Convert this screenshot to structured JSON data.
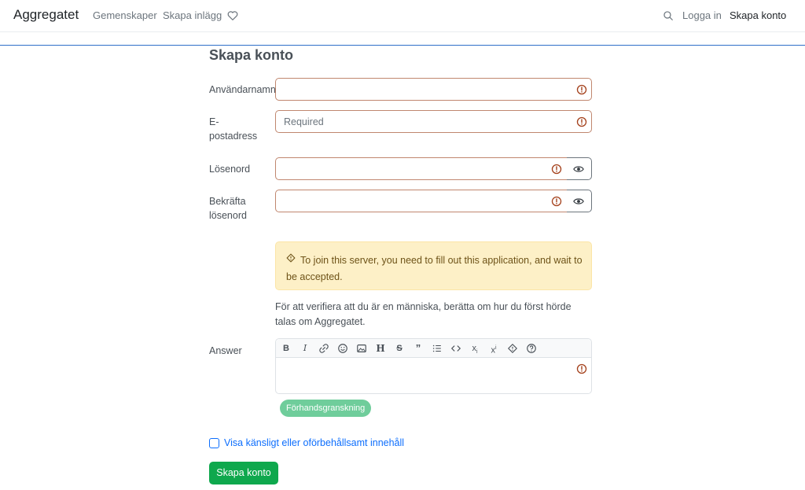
{
  "nav": {
    "brand": "Aggregatet",
    "links": [
      "Gemenskaper",
      "Skapa inlägg"
    ],
    "login": "Logga in",
    "signup": "Skapa konto"
  },
  "form": {
    "title": "Skapa konto",
    "username_label": "Användarnamn",
    "email_label_1": "E-",
    "email_label_2": "postadress",
    "email_placeholder": "Required",
    "password_label": "Lösenord",
    "confirm_label_1": "Bekräfta",
    "confirm_label_2": "lösenord",
    "application_alert": "To join this server, you need to fill out this application, and wait to be accepted.",
    "verify_question": "För att verifiera att du är en människa, berätta om hur du först hörde talas om Aggregatet.",
    "answer_label": "Answer",
    "preview_button": "Förhandsgranskning",
    "nsfw_label": "Visa känsligt eller oförbehållsamt innehåll",
    "submit_button": "Skapa konto"
  },
  "toolbar_icons": [
    "bold-icon",
    "italic-icon",
    "link-icon",
    "emoji-icon",
    "image-icon",
    "header-icon",
    "strikethrough-icon",
    "quote-icon",
    "list-icon",
    "code-icon",
    "subscript-icon",
    "superscript-icon",
    "spoiler-icon",
    "help-icon"
  ],
  "colors": {
    "error": "#a4411c",
    "alert_bg": "#fdf0c7",
    "primary": "#0d6efd",
    "success": "#0fa84d",
    "preview": "#6fcd9b"
  }
}
